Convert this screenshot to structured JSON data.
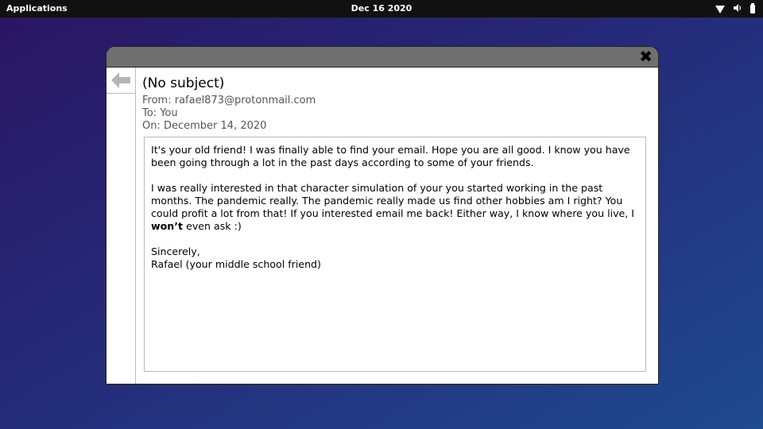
{
  "topbar": {
    "applications": "Applications",
    "date": "Dec 16 2020",
    "icons": [
      "wifi-icon",
      "volume-icon",
      "battery-icon"
    ]
  },
  "email": {
    "subject": "(No subject)",
    "from": "From: rafael873@protonmail.com",
    "to": "To: You",
    "on": "On: December 14, 2020",
    "p1": "It's your old friend! I was finally able to find your email. Hope you are all good. I know you have been going through a lot in the past days according to some of your friends.",
    "p2_before": "I was really interested in that character simulation of your you started working in the past months. The pandemic really. The pandemic really made us find other hobbies am I right? You could profit a lot from that! If you interested email me back! Either way, I know where you live, I ",
    "p2_bold": "won’t",
    "p2_after": " even ask :)",
    "sign1": "Sincerely,",
    "sign2": "Rafael (your middle school friend)"
  },
  "window": {
    "close_icon": "close-icon",
    "back_icon": "back-arrow-icon"
  }
}
